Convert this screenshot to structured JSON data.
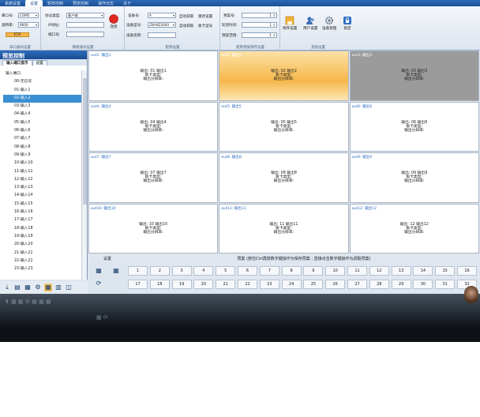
{
  "menu": {
    "tabs": [
      "系统设置",
      "设置",
      "矩阵控制",
      "预览控制",
      "操作日志",
      "关于"
    ],
    "active_index": 1
  },
  "ribbon": {
    "serial": {
      "port_label": "串口号:",
      "port_value": "COM5",
      "baud_label": "波特率:",
      "baud_value": "9600",
      "open_button": "打开",
      "caption": "串口通讯设置"
    },
    "network": {
      "protocol_label": "协议类型:",
      "protocol_value": "客户端",
      "ip_label": "IP地址:",
      "ip_value": "",
      "port_label": "端口号:",
      "port_value": "",
      "connect_button": "连接",
      "caption": "网络通讯设置"
    },
    "matrix": {
      "device_no_label": "设备号:",
      "device_no_value": "A",
      "device_type_label": "设备型号:",
      "device_type_value": "ZW-KD3000",
      "device_name_label": "设备名称:",
      "device_name_value": "",
      "auto_get": "自动获取",
      "reset": "重新设置",
      "auto_get2": "自动获取",
      "board_type": "板卡型号",
      "caption": "矩阵设置"
    },
    "roll": {
      "preset_label": "预案号:",
      "preset_value": "1",
      "interval_label": "轮巡时间:",
      "interval_value": "1",
      "range_label": "预案范围:",
      "range_value": "1",
      "caption": "矩阵预案保存设置"
    },
    "other": {
      "save_label": "保存设置",
      "user_label": "用户设置",
      "device_mgmt_label": "设备管理",
      "lock_label": "锁定",
      "caption": "其他设置"
    }
  },
  "left": {
    "title": "预览控制",
    "tabs": [
      "输入端口显示",
      "设置"
    ],
    "tree_root": "输入端口",
    "tree_items": [
      "00-无信号",
      "01-输入1",
      "02-输入2",
      "03-输入3",
      "04-输入4",
      "05-输入5",
      "06-输入6",
      "07-输入7",
      "08-输入8",
      "09-输入9",
      "10-输入10",
      "11-输入11",
      "12-输入12",
      "13-输入13",
      "14-输入14",
      "15-输入15",
      "16-输入16",
      "17-输入17",
      "18-输入18",
      "19-输入19",
      "20-输入20",
      "21-输入21",
      "22-输入22",
      "23-输入23"
    ],
    "selected_index": 2,
    "toolbar": [
      "download-icon",
      "grid-icon",
      "grid9-icon",
      "gear-icon",
      "grid4-icon",
      "chart-icon",
      "layout-icon"
    ]
  },
  "outputs": [
    {
      "header": "out1: 输出1",
      "line1": "输出: 01  输出1",
      "line2": "板卡类型:",
      "line3": "输出分辨率:",
      "style": "normal"
    },
    {
      "header": "out2: 输出2",
      "line1": "输出: 02  输出2",
      "line2": "板卡类型:",
      "line3": "输出分辨率:",
      "style": "orange"
    },
    {
      "header": "out3: 输出3",
      "line1": "输出: 03  输出3",
      "line2": "板卡类型:",
      "line3": "输出分辨率:",
      "style": "gray"
    },
    {
      "header": "out4: 输出4",
      "line1": "输出: 04  输出4",
      "line2": "板卡类型:",
      "line3": "输出分辨率:",
      "style": "normal"
    },
    {
      "header": "out5: 输出5",
      "line1": "输出: 05  输出5",
      "line2": "板卡类型:",
      "line3": "输出分辨率:",
      "style": "normal"
    },
    {
      "header": "out6: 输出6",
      "line1": "输出: 06  输出6",
      "line2": "板卡类型:",
      "line3": "输出分辨率:",
      "style": "normal"
    },
    {
      "header": "out7: 输出7",
      "line1": "输出: 07  输出7",
      "line2": "板卡类型:",
      "line3": "输出分辨率:",
      "style": "normal"
    },
    {
      "header": "out8: 输出8",
      "line1": "输出: 08  输出8",
      "line2": "板卡类型:",
      "line3": "输出分辨率:",
      "style": "normal"
    },
    {
      "header": "out9: 输出9",
      "line1": "输出: 09  输出9",
      "line2": "板卡类型:",
      "line3": "输出分辨率:",
      "style": "normal"
    },
    {
      "header": "out10: 输出10",
      "line1": "输出: 10  输出10",
      "line2": "板卡类型:",
      "line3": "输出分辨率:",
      "style": "normal"
    },
    {
      "header": "out11: 输出11",
      "line1": "输出: 11  输出11",
      "line2": "板卡类型:",
      "line3": "输出分辨率:",
      "style": "normal"
    },
    {
      "header": "out12: 输出12",
      "line1": "输出: 12  输出12",
      "line2": "板卡类型:",
      "line3": "输出分辨率:",
      "style": "normal"
    }
  ],
  "presets": {
    "settings_label": "设置",
    "title": "预案 (按住Ctrl再按数字键操作为保存预案 ; 直接点击数字键操作为调取预案)",
    "keys": [
      "1",
      "2",
      "3",
      "4",
      "5",
      "6",
      "7",
      "8",
      "9",
      "10",
      "11",
      "12",
      "13",
      "14",
      "15",
      "16",
      "17",
      "18",
      "19",
      "20",
      "21",
      "22",
      "23",
      "24",
      "25",
      "26",
      "27",
      "28",
      "29",
      "30",
      "31",
      "32"
    ]
  },
  "colors": {
    "accent": "#2c6ab8",
    "selected": "#3a8fd3",
    "orange": "#f6b74a",
    "gray": "#9b9b9b"
  }
}
